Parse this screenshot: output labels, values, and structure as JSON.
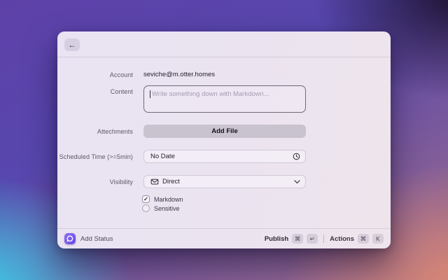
{
  "icons": {
    "back": "←",
    "check": "✓"
  },
  "form": {
    "account": {
      "label": "Account",
      "value": "seviche@m.otter.homes"
    },
    "content": {
      "label": "Content",
      "placeholder": "Write something down with Markdown..."
    },
    "attachments": {
      "label": "Attechments",
      "button": "Add File"
    },
    "scheduled_time": {
      "label": "Scheduled Time (>=5min)",
      "value": "No Date"
    },
    "visibility": {
      "label": "Visibility",
      "value": "Direct"
    },
    "options": [
      {
        "label": "Markdown",
        "checked": true
      },
      {
        "label": "Sensitive",
        "checked": false
      }
    ]
  },
  "footer": {
    "app_title": "Add Status",
    "publish": {
      "label": "Publish",
      "keys": [
        "⌘",
        "↵"
      ]
    },
    "actions": {
      "label": "Actions",
      "keys": [
        "⌘",
        "K"
      ]
    }
  },
  "colors": {
    "accent_purple": "#7c5ce8",
    "dialog_bg": "#eae3f0",
    "add_file_bg": "#c9c2cf",
    "bg_top": "#5e41a8",
    "bg_bottom_left": "#38d7ef",
    "bg_bottom_right": "#e28a70",
    "bg_top_right": "#1c112d"
  }
}
